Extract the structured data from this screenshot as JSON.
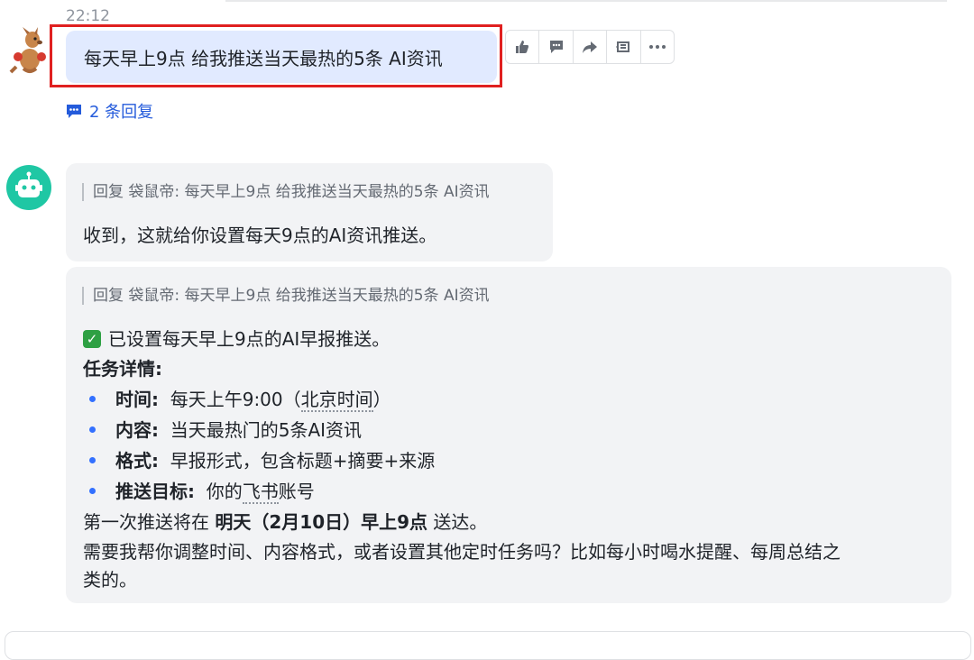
{
  "header": {
    "time": "22:12"
  },
  "user_message": {
    "sender": "袋鼠帝",
    "text": "每天早上9点 给我推送当天最热的5条 AI资讯",
    "reply_count": "2 条回复"
  },
  "actions": [
    {
      "icon": "thumbs-up-icon"
    },
    {
      "icon": "comment-icon"
    },
    {
      "icon": "forward-icon"
    },
    {
      "icon": "pin-icon"
    },
    {
      "icon": "more-icon"
    }
  ],
  "bot_reply_1": {
    "quote": "回复 袋鼠帝: 每天早上9点 给我推送当天最热的5条 AI资讯",
    "text": "收到，这就给你设置每天9点的AI资讯推送。"
  },
  "bot_reply_2": {
    "quote": "回复 袋鼠帝: 每天早上9点 给我推送当天最热的5条 AI资讯",
    "confirm": "已设置每天早上9点的AI早报推送。",
    "details_title": "任务详情:",
    "items": [
      {
        "label": "时间:",
        "value_a": "每天上午9:00（",
        "value_b": "北京时间",
        "value_c": "）"
      },
      {
        "label": "内容:",
        "value": "当天最热门的5条AI资讯"
      },
      {
        "label": "格式:",
        "value": "早报形式，包含标题+摘要+来源"
      },
      {
        "label": "推送目标:",
        "value_a": "你的",
        "value_b": "飞书",
        "value_c": "账号"
      }
    ],
    "first_push_prefix": "第一次推送将在 ",
    "first_push_bold": "明天（2月10日）早上9点",
    "first_push_suffix": " 送达。",
    "followup_line1": "需要我帮你调整时间、内容格式，或者设置其他定时任务吗？比如每小时喝水提醒、每周总结之",
    "followup_line2": "类的。"
  }
}
